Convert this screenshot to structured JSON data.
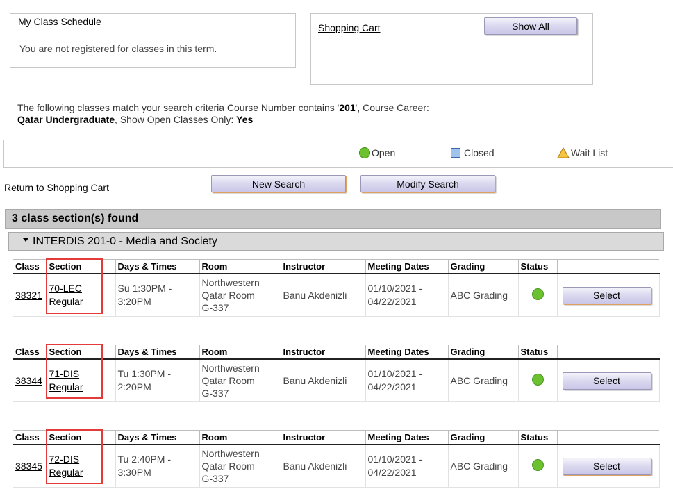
{
  "schedule": {
    "title": "My Class Schedule",
    "message": "You are not registered for classes in this term."
  },
  "cart": {
    "title": "Shopping Cart",
    "show_all_label": "Show All"
  },
  "criteria": {
    "prefix": "The following classes match your search criteria Course Number contains '",
    "course_number": "201",
    "mid": "',  Course Career:",
    "career": "Qatar Undergraduate",
    "open_label": ",  Show Open Classes Only: ",
    "open_value": "Yes"
  },
  "legend": {
    "open": "Open",
    "closed": "Closed",
    "wait": "Wait List"
  },
  "nav": {
    "return_label": "Return to Shopping Cart",
    "new_search_label": "New Search",
    "modify_search_label": "Modify Search"
  },
  "results": {
    "found_label": "3 class section(s) found",
    "course_title": "INTERDIS 201-0 - Media and Society"
  },
  "colors": {
    "open_status": "#6cc130",
    "highlight": "#e33a3a"
  },
  "table_headers": [
    "Class",
    "Section",
    "Days & Times",
    "Room",
    "Instructor",
    "Meeting Dates",
    "Grading",
    "Status",
    ""
  ],
  "sections": [
    {
      "class_nbr": "38321",
      "section": "70-LEC",
      "section_type": "Regular",
      "days1": "Su 1:30PM -",
      "days2": "3:20PM",
      "room1": "Northwestern",
      "room2": "Qatar Room",
      "room3": "G-337",
      "instructor": "Banu Akdenizli",
      "dates1": "01/10/2021 -",
      "dates2": "04/22/2021",
      "grading": "ABC Grading",
      "status": "open-icon",
      "select_label": "Select"
    },
    {
      "class_nbr": "38344",
      "section": "71-DIS",
      "section_type": "Regular",
      "days1": "Tu 1:30PM -",
      "days2": "2:20PM",
      "room1": "Northwestern",
      "room2": "Qatar Room",
      "room3": "G-337",
      "instructor": "Banu Akdenizli",
      "dates1": "01/10/2021 -",
      "dates2": "04/22/2021",
      "grading": "ABC Grading",
      "status": "open-icon",
      "select_label": "Select"
    },
    {
      "class_nbr": "38345",
      "section": "72-DIS",
      "section_type": "Regular",
      "days1": "Tu 2:40PM -",
      "days2": "3:30PM",
      "room1": "Northwestern",
      "room2": "Qatar Room",
      "room3": "G-337",
      "instructor": "Banu Akdenizli",
      "dates1": "01/10/2021 -",
      "dates2": "04/22/2021",
      "grading": "ABC Grading",
      "status": "open-icon",
      "select_label": "Select"
    }
  ]
}
